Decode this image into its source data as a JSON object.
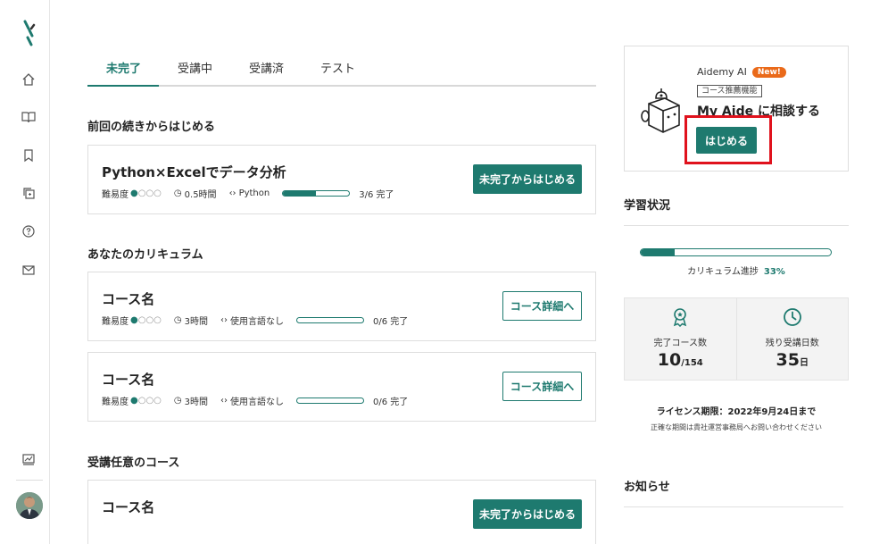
{
  "colors": {
    "accent": "#1e7a6f",
    "badge": "#ea6a1a",
    "highlight": "#e0121d"
  },
  "sidebar": {
    "items": [
      {
        "icon": "home-icon"
      },
      {
        "icon": "book-icon"
      },
      {
        "icon": "bookmark-icon"
      },
      {
        "icon": "layers-icon"
      },
      {
        "icon": "help-icon"
      },
      {
        "icon": "mail-icon"
      },
      {
        "icon": "chart-icon"
      }
    ]
  },
  "tabs": [
    {
      "label": "未完了",
      "active": true
    },
    {
      "label": "受講中"
    },
    {
      "label": "受講済"
    },
    {
      "label": "テスト"
    }
  ],
  "sections": {
    "continue": "前回の続きからはじめる",
    "curriculum": "あなたのカリキュラム",
    "optional": "受講任意のコース"
  },
  "courses": {
    "c1": {
      "title": "Python×Excelでデータ分析",
      "difficulty_label": "難易度",
      "time": "0.5時間",
      "language": "Python",
      "progress": 0.5,
      "progress_text": "3/6 完了",
      "button": "未完了からはじめる"
    },
    "c2": {
      "title": "コース名",
      "difficulty_label": "難易度",
      "time": "3時間",
      "language": "使用言語なし",
      "progress": 0,
      "progress_text": "0/6 完了",
      "button": "コース詳細へ"
    },
    "c3": {
      "title": "コース名",
      "difficulty_label": "難易度",
      "time": "3時間",
      "language": "使用言語なし",
      "progress": 0,
      "progress_text": "0/6 完了",
      "button": "コース詳細へ"
    },
    "c4": {
      "title": "コース名",
      "button": "未完了からはじめる"
    }
  },
  "ai": {
    "name": "Aidemy AI",
    "badge": "New!",
    "tag": "コース推薦機能",
    "heading": "My Aide に相談する",
    "button": "はじめる"
  },
  "status": {
    "title": "学習状況",
    "curriculum_label": "カリキュラム進捗",
    "curriculum_pct": "33%",
    "curriculum_progress": 0.18,
    "completed_label": "完了コース数",
    "completed_value": "10",
    "completed_total": "/154",
    "remaining_label": "残り受講日数",
    "remaining_value": "35",
    "remaining_unit": "日",
    "license": "ライセンス期限：2022年9月24日まで",
    "license_note": "正確な期間は貴社運営事務局へお問い合わせください"
  },
  "news": {
    "title": "お知らせ"
  }
}
